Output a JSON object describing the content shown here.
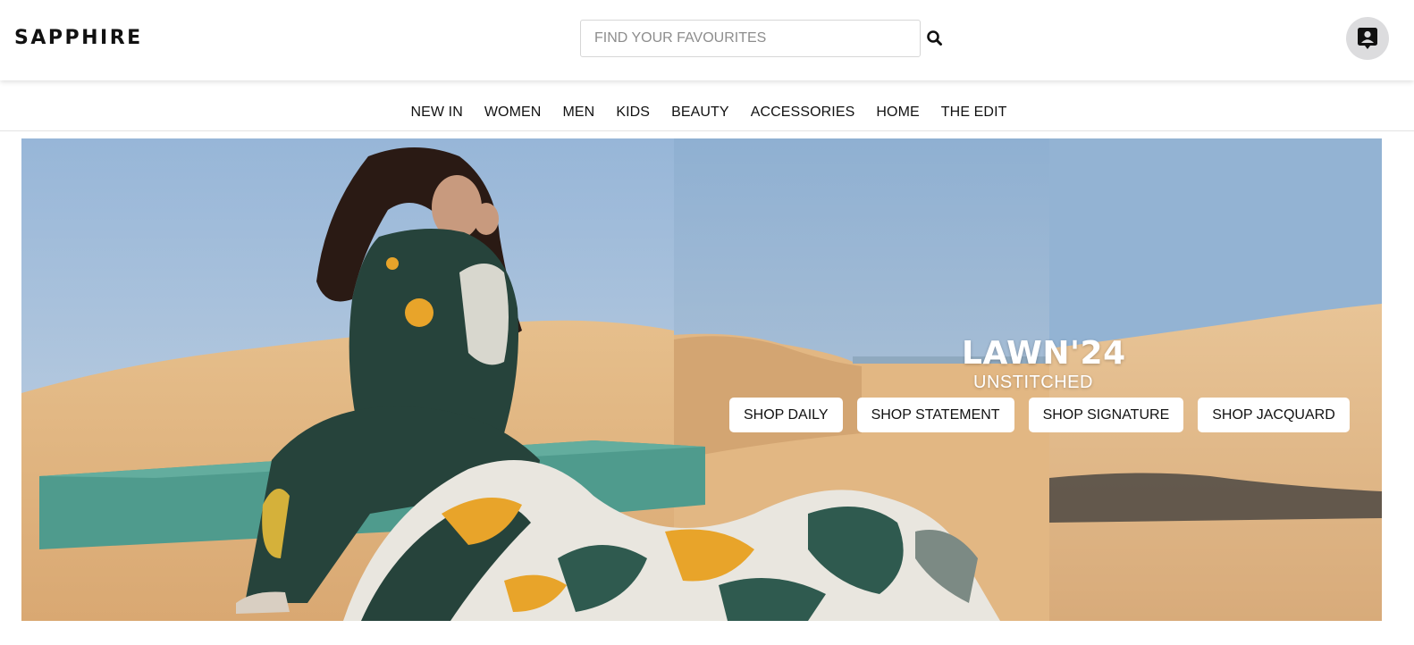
{
  "header": {
    "logo": "SAPPHIRE",
    "search_placeholder": "FIND YOUR FAVOURITES",
    "search_icon": "search-icon",
    "account_icon": "account-icon"
  },
  "nav": {
    "items": [
      "NEW IN",
      "WOMEN",
      "MEN",
      "KIDS",
      "BEAUTY",
      "ACCESSORIES",
      "HOME",
      "THE EDIT"
    ]
  },
  "hero": {
    "title": "LAWN'24",
    "subtitle": "UNSTITCHED",
    "buttons": [
      "SHOP DAILY",
      "SHOP STATEMENT",
      "SHOP SIGNATURE",
      "SHOP JACQUARD"
    ],
    "image_description_icon": "desert-fashion-banner-image"
  },
  "colors": {
    "sky": "#9fbbd8",
    "sand": "#e3b886",
    "teal_block": "#4e9a8c",
    "outfit_green": "#26433b",
    "accent_yellow": "#e8a42a"
  }
}
